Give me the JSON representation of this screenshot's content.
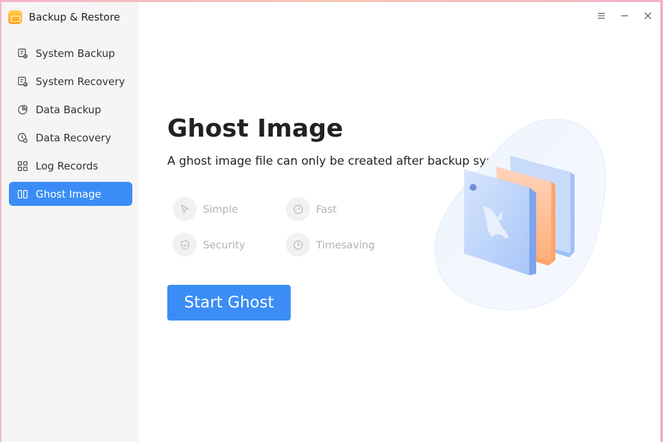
{
  "app": {
    "title": "Backup & Restore",
    "logo_icon": "backup-restore-logo"
  },
  "sidebar": {
    "items": [
      {
        "label": "System Backup",
        "icon": "system-backup-icon",
        "active": false
      },
      {
        "label": "System Recovery",
        "icon": "system-recovery-icon",
        "active": false
      },
      {
        "label": "Data Backup",
        "icon": "data-backup-icon",
        "active": false
      },
      {
        "label": "Data Recovery",
        "icon": "data-recovery-icon",
        "active": false
      },
      {
        "label": "Log Records",
        "icon": "log-records-icon",
        "active": false
      },
      {
        "label": "Ghost Image",
        "icon": "ghost-image-icon",
        "active": true
      }
    ]
  },
  "window_controls": {
    "menu_icon": "menu-icon",
    "minimize_icon": "minimize-icon",
    "close_icon": "close-icon"
  },
  "main": {
    "title": "Ghost Image",
    "subtitle": "A ghost image file can only be created after backup system to local disk",
    "features": [
      {
        "label": "Simple",
        "icon": "simple-icon"
      },
      {
        "label": "Fast",
        "icon": "fast-icon"
      },
      {
        "label": "Security",
        "icon": "security-icon"
      },
      {
        "label": "Timesaving",
        "icon": "timesaving-icon"
      }
    ],
    "start_button": "Start Ghost"
  },
  "colors": {
    "accent": "#3b8df5",
    "sidebar_bg": "#f5f5f5",
    "feature_text": "#b3b3b3"
  }
}
